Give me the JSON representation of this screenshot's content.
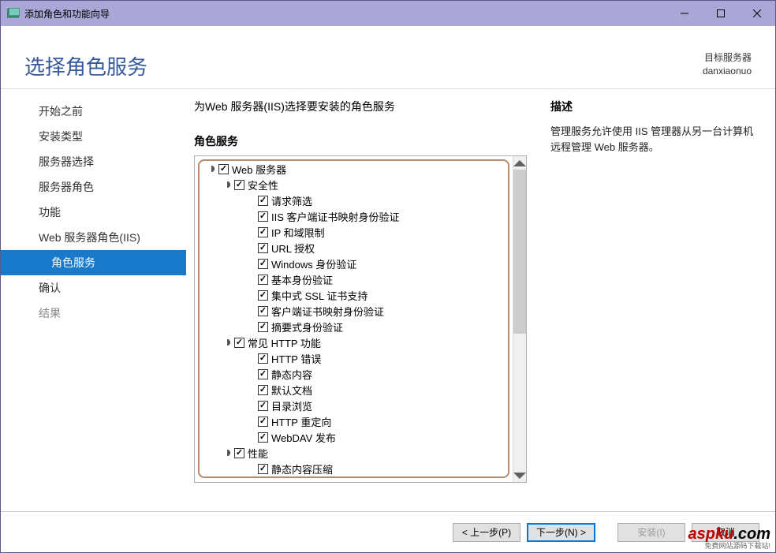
{
  "window": {
    "title": "添加角色和功能向导"
  },
  "header": {
    "page_title": "选择角色服务",
    "target_label": "目标服务器",
    "target_name": "danxiaonuo"
  },
  "sidebar": {
    "items": [
      {
        "label": "开始之前",
        "active": false,
        "sub": false
      },
      {
        "label": "安装类型",
        "active": false,
        "sub": false
      },
      {
        "label": "服务器选择",
        "active": false,
        "sub": false
      },
      {
        "label": "服务器角色",
        "active": false,
        "sub": false
      },
      {
        "label": "功能",
        "active": false,
        "sub": false
      },
      {
        "label": "Web 服务器角色(IIS)",
        "active": false,
        "sub": false
      },
      {
        "label": "角色服务",
        "active": true,
        "sub": true
      },
      {
        "label": "确认",
        "active": false,
        "sub": false
      },
      {
        "label": "结果",
        "active": false,
        "sub": false,
        "disabled": true
      }
    ]
  },
  "content": {
    "intro": "为Web 服务器(IIS)选择要安装的角色服务",
    "section_label": "角色服务",
    "desc_label": "描述",
    "desc_text": "管理服务允许使用 IIS 管理器从另一台计算机远程管理 Web 服务器。"
  },
  "tree": [
    {
      "indent": 0,
      "expander": "open",
      "checked": true,
      "label": "Web 服务器"
    },
    {
      "indent": 1,
      "expander": "open",
      "checked": true,
      "label": "安全性"
    },
    {
      "indent": 2,
      "expander": "",
      "checked": true,
      "label": "请求筛选"
    },
    {
      "indent": 2,
      "expander": "",
      "checked": true,
      "label": "IIS 客户端证书映射身份验证"
    },
    {
      "indent": 2,
      "expander": "",
      "checked": true,
      "label": "IP 和域限制"
    },
    {
      "indent": 2,
      "expander": "",
      "checked": true,
      "label": "URL 授权"
    },
    {
      "indent": 2,
      "expander": "",
      "checked": true,
      "label": "Windows 身份验证"
    },
    {
      "indent": 2,
      "expander": "",
      "checked": true,
      "label": "基本身份验证"
    },
    {
      "indent": 2,
      "expander": "",
      "checked": true,
      "label": "集中式 SSL 证书支持"
    },
    {
      "indent": 2,
      "expander": "",
      "checked": true,
      "label": "客户端证书映射身份验证"
    },
    {
      "indent": 2,
      "expander": "",
      "checked": true,
      "label": "摘要式身份验证"
    },
    {
      "indent": 1,
      "expander": "open",
      "checked": true,
      "label": "常见 HTTP 功能"
    },
    {
      "indent": 2,
      "expander": "",
      "checked": true,
      "label": "HTTP 错误"
    },
    {
      "indent": 2,
      "expander": "",
      "checked": true,
      "label": "静态内容"
    },
    {
      "indent": 2,
      "expander": "",
      "checked": true,
      "label": "默认文档"
    },
    {
      "indent": 2,
      "expander": "",
      "checked": true,
      "label": "目录浏览"
    },
    {
      "indent": 2,
      "expander": "",
      "checked": true,
      "label": "HTTP 重定向"
    },
    {
      "indent": 2,
      "expander": "",
      "checked": true,
      "label": "WebDAV 发布"
    },
    {
      "indent": 1,
      "expander": "open",
      "checked": true,
      "label": "性能"
    },
    {
      "indent": 2,
      "expander": "",
      "checked": true,
      "label": "静态内容压缩"
    }
  ],
  "footer": {
    "prev": "< 上一步(P)",
    "next": "下一步(N) >",
    "install": "安装(I)",
    "cancel": "取消"
  },
  "watermark": {
    "brand": "aspku",
    "suffix": ".com",
    "tagline": "免费网站源码下载站!"
  }
}
